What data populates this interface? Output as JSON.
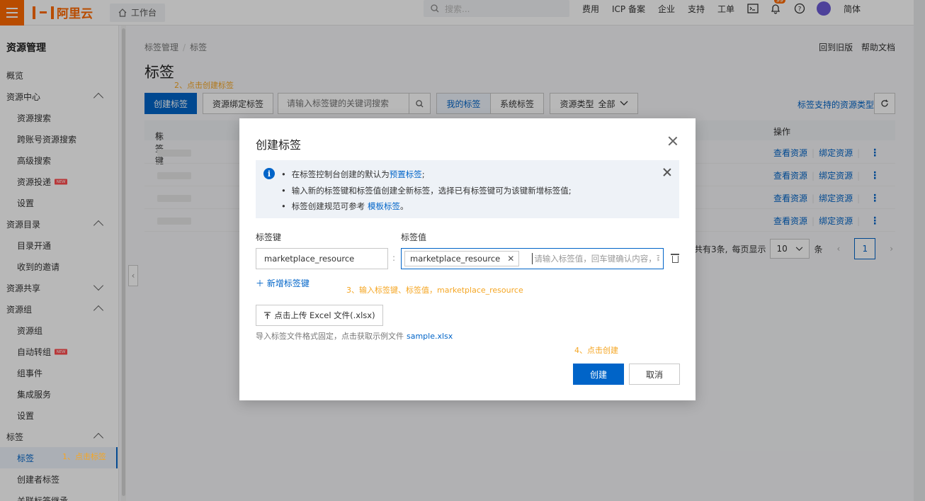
{
  "topbar": {
    "logo": "阿里云",
    "workbench": "工作台",
    "search_placeholder": "搜索...",
    "nav": [
      "费用",
      "ICP 备案",
      "企业",
      "支持",
      "工单"
    ],
    "bell_count": "99",
    "language": "简体",
    "brand_color": "#ff6a00"
  },
  "sidebar": {
    "title": "资源管理",
    "items": [
      {
        "label": "概览",
        "level": 1
      },
      {
        "label": "资源中心",
        "level": 1,
        "chevron": "up"
      },
      {
        "label": "资源搜索",
        "level": 2
      },
      {
        "label": "跨账号资源搜索",
        "level": 2
      },
      {
        "label": "高级搜索",
        "level": 2
      },
      {
        "label": "资源投递",
        "level": 2,
        "badge": "NEW"
      },
      {
        "label": "设置",
        "level": 2
      },
      {
        "label": "资源目录",
        "level": 1,
        "chevron": "up"
      },
      {
        "label": "目录开通",
        "level": 2
      },
      {
        "label": "收到的邀请",
        "level": 2
      },
      {
        "label": "资源共享",
        "level": 1,
        "chevron": "down"
      },
      {
        "label": "资源组",
        "level": 1,
        "chevron": "up"
      },
      {
        "label": "资源组",
        "level": 2
      },
      {
        "label": "自动转组",
        "level": 2,
        "badge": "NEW"
      },
      {
        "label": "组事件",
        "level": 2
      },
      {
        "label": "集成服务",
        "level": 2
      },
      {
        "label": "设置",
        "level": 2
      },
      {
        "label": "标签",
        "level": 1,
        "chevron": "up"
      },
      {
        "label": "标签",
        "level": 2,
        "active": true
      },
      {
        "label": "创建者标签",
        "level": 2
      },
      {
        "label": "关联标签继承",
        "level": 2
      }
    ]
  },
  "breadcrumb": [
    "标签管理",
    "标签"
  ],
  "page_title": "标签",
  "top_links": [
    "回到旧版",
    "帮助文档"
  ],
  "annotations": {
    "step1": "1、点击标签",
    "step2": "2、点击创建标签",
    "step3": "3、输入标签键、标签值，marketplace_resource",
    "step4": "4、点击创建"
  },
  "toolbar": {
    "create_label": "创建标签",
    "bind_label": "资源绑定标签",
    "search_placeholder": "请输入标签键的关键词搜索",
    "my_tags": "我的标签",
    "system_tags": "系统标签",
    "resource_type_label": "资源类型",
    "resource_type_value": "全部",
    "supported_types_link": "标签支持的资源类型"
  },
  "table": {
    "col_key": "标签键",
    "col_ops": "操作",
    "rows": [
      {
        "view": "查看资源",
        "bind": "绑定资源"
      },
      {
        "view": "查看资源",
        "bind": "绑定资源"
      },
      {
        "view": "查看资源",
        "bind": "绑定资源"
      },
      {
        "view": "查看资源",
        "bind": "绑定资源"
      }
    ]
  },
  "pagination": {
    "total_text": "共有3条,",
    "page_size_label": "每页显示",
    "page_size": "10",
    "unit": "条",
    "current_page": "1"
  },
  "dialog": {
    "title": "创建标签",
    "notice": {
      "line1_prefix": "在标签控制台创建的默认为",
      "line1_link": "预置标签",
      "line1_suffix": ";",
      "line2": "输入新的标签键和标签值创建全新标签，选择已有标签键可为该键新增标签值;",
      "line3_prefix": "标签创建规范可参考",
      "line3_link": "模板标签",
      "line3_suffix": "。"
    },
    "key_label": "标签键",
    "value_label": "标签值",
    "key_value": "marketplace_resource",
    "value_chip": "marketplace_resource",
    "value_placeholder": "请输入标签值，回车键确认内容，可",
    "add_key": "新增标签键",
    "upload_label": "点击上传 Excel 文件(.xlsx)",
    "import_hint": "导入标签文件格式固定，点击获取示例文件",
    "sample_link": "sample.xlsx",
    "ok": "创建",
    "cancel": "取消"
  }
}
